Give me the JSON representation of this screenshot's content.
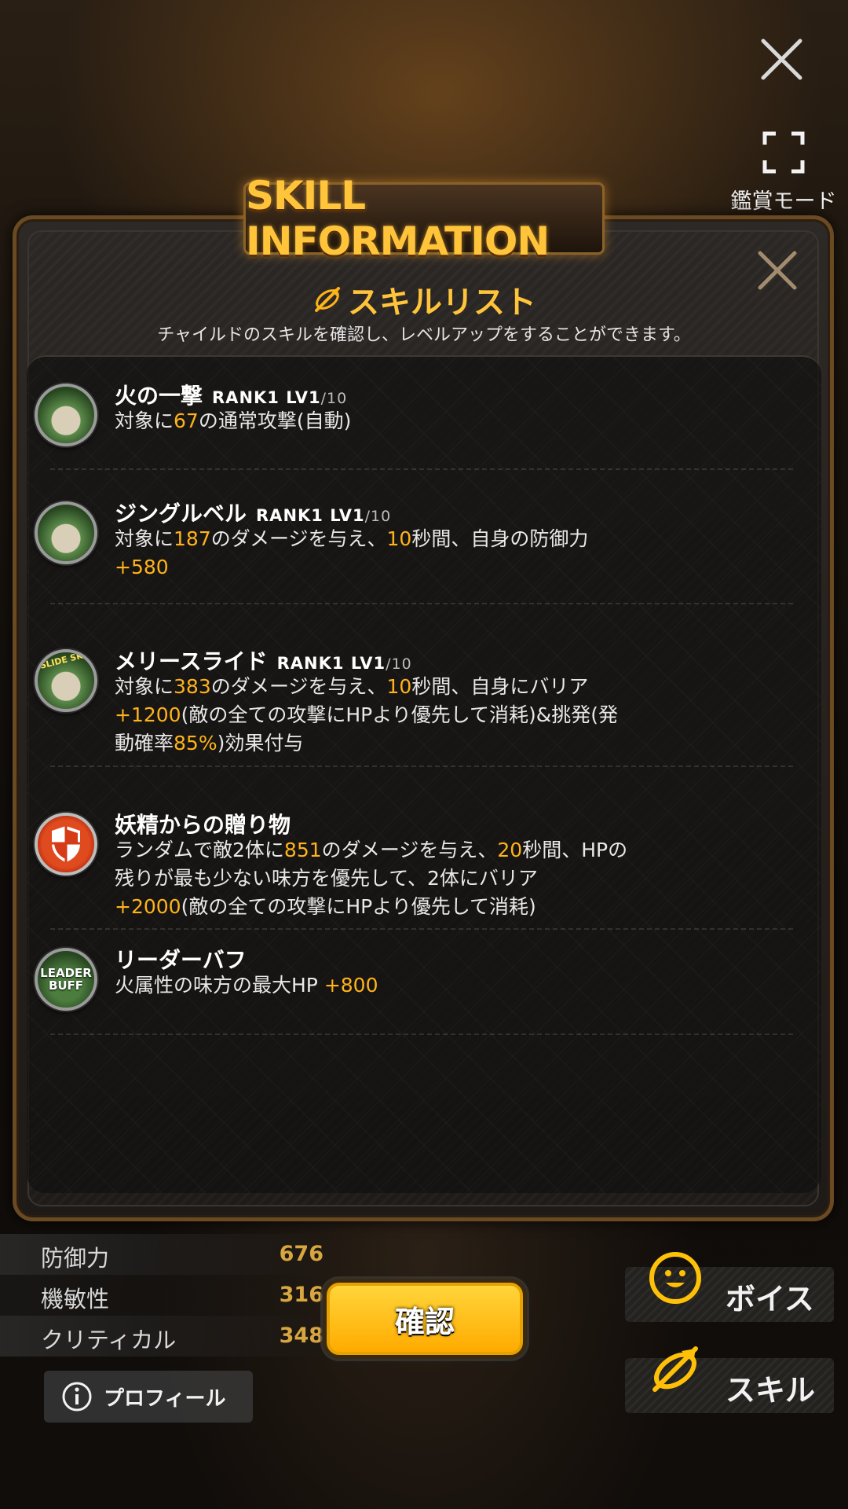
{
  "top_controls": {
    "view_mode_label": "鑑賞モード"
  },
  "dialog": {
    "banner": "SKILL INFORMATION",
    "title": "スキルリスト",
    "description": "チャイルドのスキルを確認し、レベルアップをすることができます。"
  },
  "skills": [
    {
      "name": "火の一撃",
      "rank": "RANK1",
      "lv": "LV1",
      "lvmax": "/10",
      "desc": [
        {
          "t": "対象に"
        },
        {
          "t": "67",
          "hl": true
        },
        {
          "t": "の通常攻撃(自動)"
        }
      ]
    },
    {
      "name": "ジングルベル",
      "rank": "RANK1",
      "lv": "LV1",
      "lvmax": "/10",
      "desc": [
        {
          "t": "対象に"
        },
        {
          "t": "187",
          "hl": true
        },
        {
          "t": "のダメージを与え、"
        },
        {
          "t": "10",
          "hl": true
        },
        {
          "t": "秒間、自身の防御力"
        },
        {
          "br": true
        },
        {
          "t": "+580",
          "hl": true
        }
      ]
    },
    {
      "name": "メリースライド",
      "rank": "RANK1",
      "lv": "LV1",
      "lvmax": "/10",
      "badge": "SLIDE SKILL",
      "desc": [
        {
          "t": "対象に"
        },
        {
          "t": "383",
          "hl": true
        },
        {
          "t": "のダメージを与え、"
        },
        {
          "t": "10",
          "hl": true
        },
        {
          "t": "秒間、自身にバリア"
        },
        {
          "br": true
        },
        {
          "t": "+1200",
          "hl": true
        },
        {
          "t": "(敵の全ての攻撃にHPより優先して消耗)&挑発(発"
        },
        {
          "br": true
        },
        {
          "t": "動確率"
        },
        {
          "t": "85%",
          "hl": true
        },
        {
          "t": ")効果付与"
        }
      ]
    },
    {
      "name": "妖精からの贈り物",
      "desc": [
        {
          "t": "ランダムで敵2体に"
        },
        {
          "t": "851",
          "hl": true
        },
        {
          "t": "のダメージを与え、"
        },
        {
          "t": "20",
          "hl": true
        },
        {
          "t": "秒間、HPの"
        },
        {
          "br": true
        },
        {
          "t": "残りが最も少ない味方を優先して、2体にバリア"
        },
        {
          "br": true
        },
        {
          "t": "+2000",
          "hl": true
        },
        {
          "t": "(敵の全ての攻撃にHPより優先して消耗)"
        }
      ]
    },
    {
      "name": "リーダーバフ",
      "badge_line1": "LEADER",
      "badge_line2": "BUFF",
      "desc": [
        {
          "t": "火属性の味方の最大HP "
        },
        {
          "t": "+800",
          "hl": true
        }
      ]
    }
  ],
  "stats": [
    {
      "label": "防御力",
      "value": "676"
    },
    {
      "label": "機敏性",
      "value": "316"
    },
    {
      "label": "クリティカル",
      "value": "348"
    }
  ],
  "buttons": {
    "confirm": "確認",
    "profile": "プロフィール",
    "voice": "ボイス",
    "skill": "スキル"
  },
  "colors": {
    "accent": "#ffb31a",
    "banner_text": "#ffc43a",
    "confirm": "#ffc107"
  }
}
